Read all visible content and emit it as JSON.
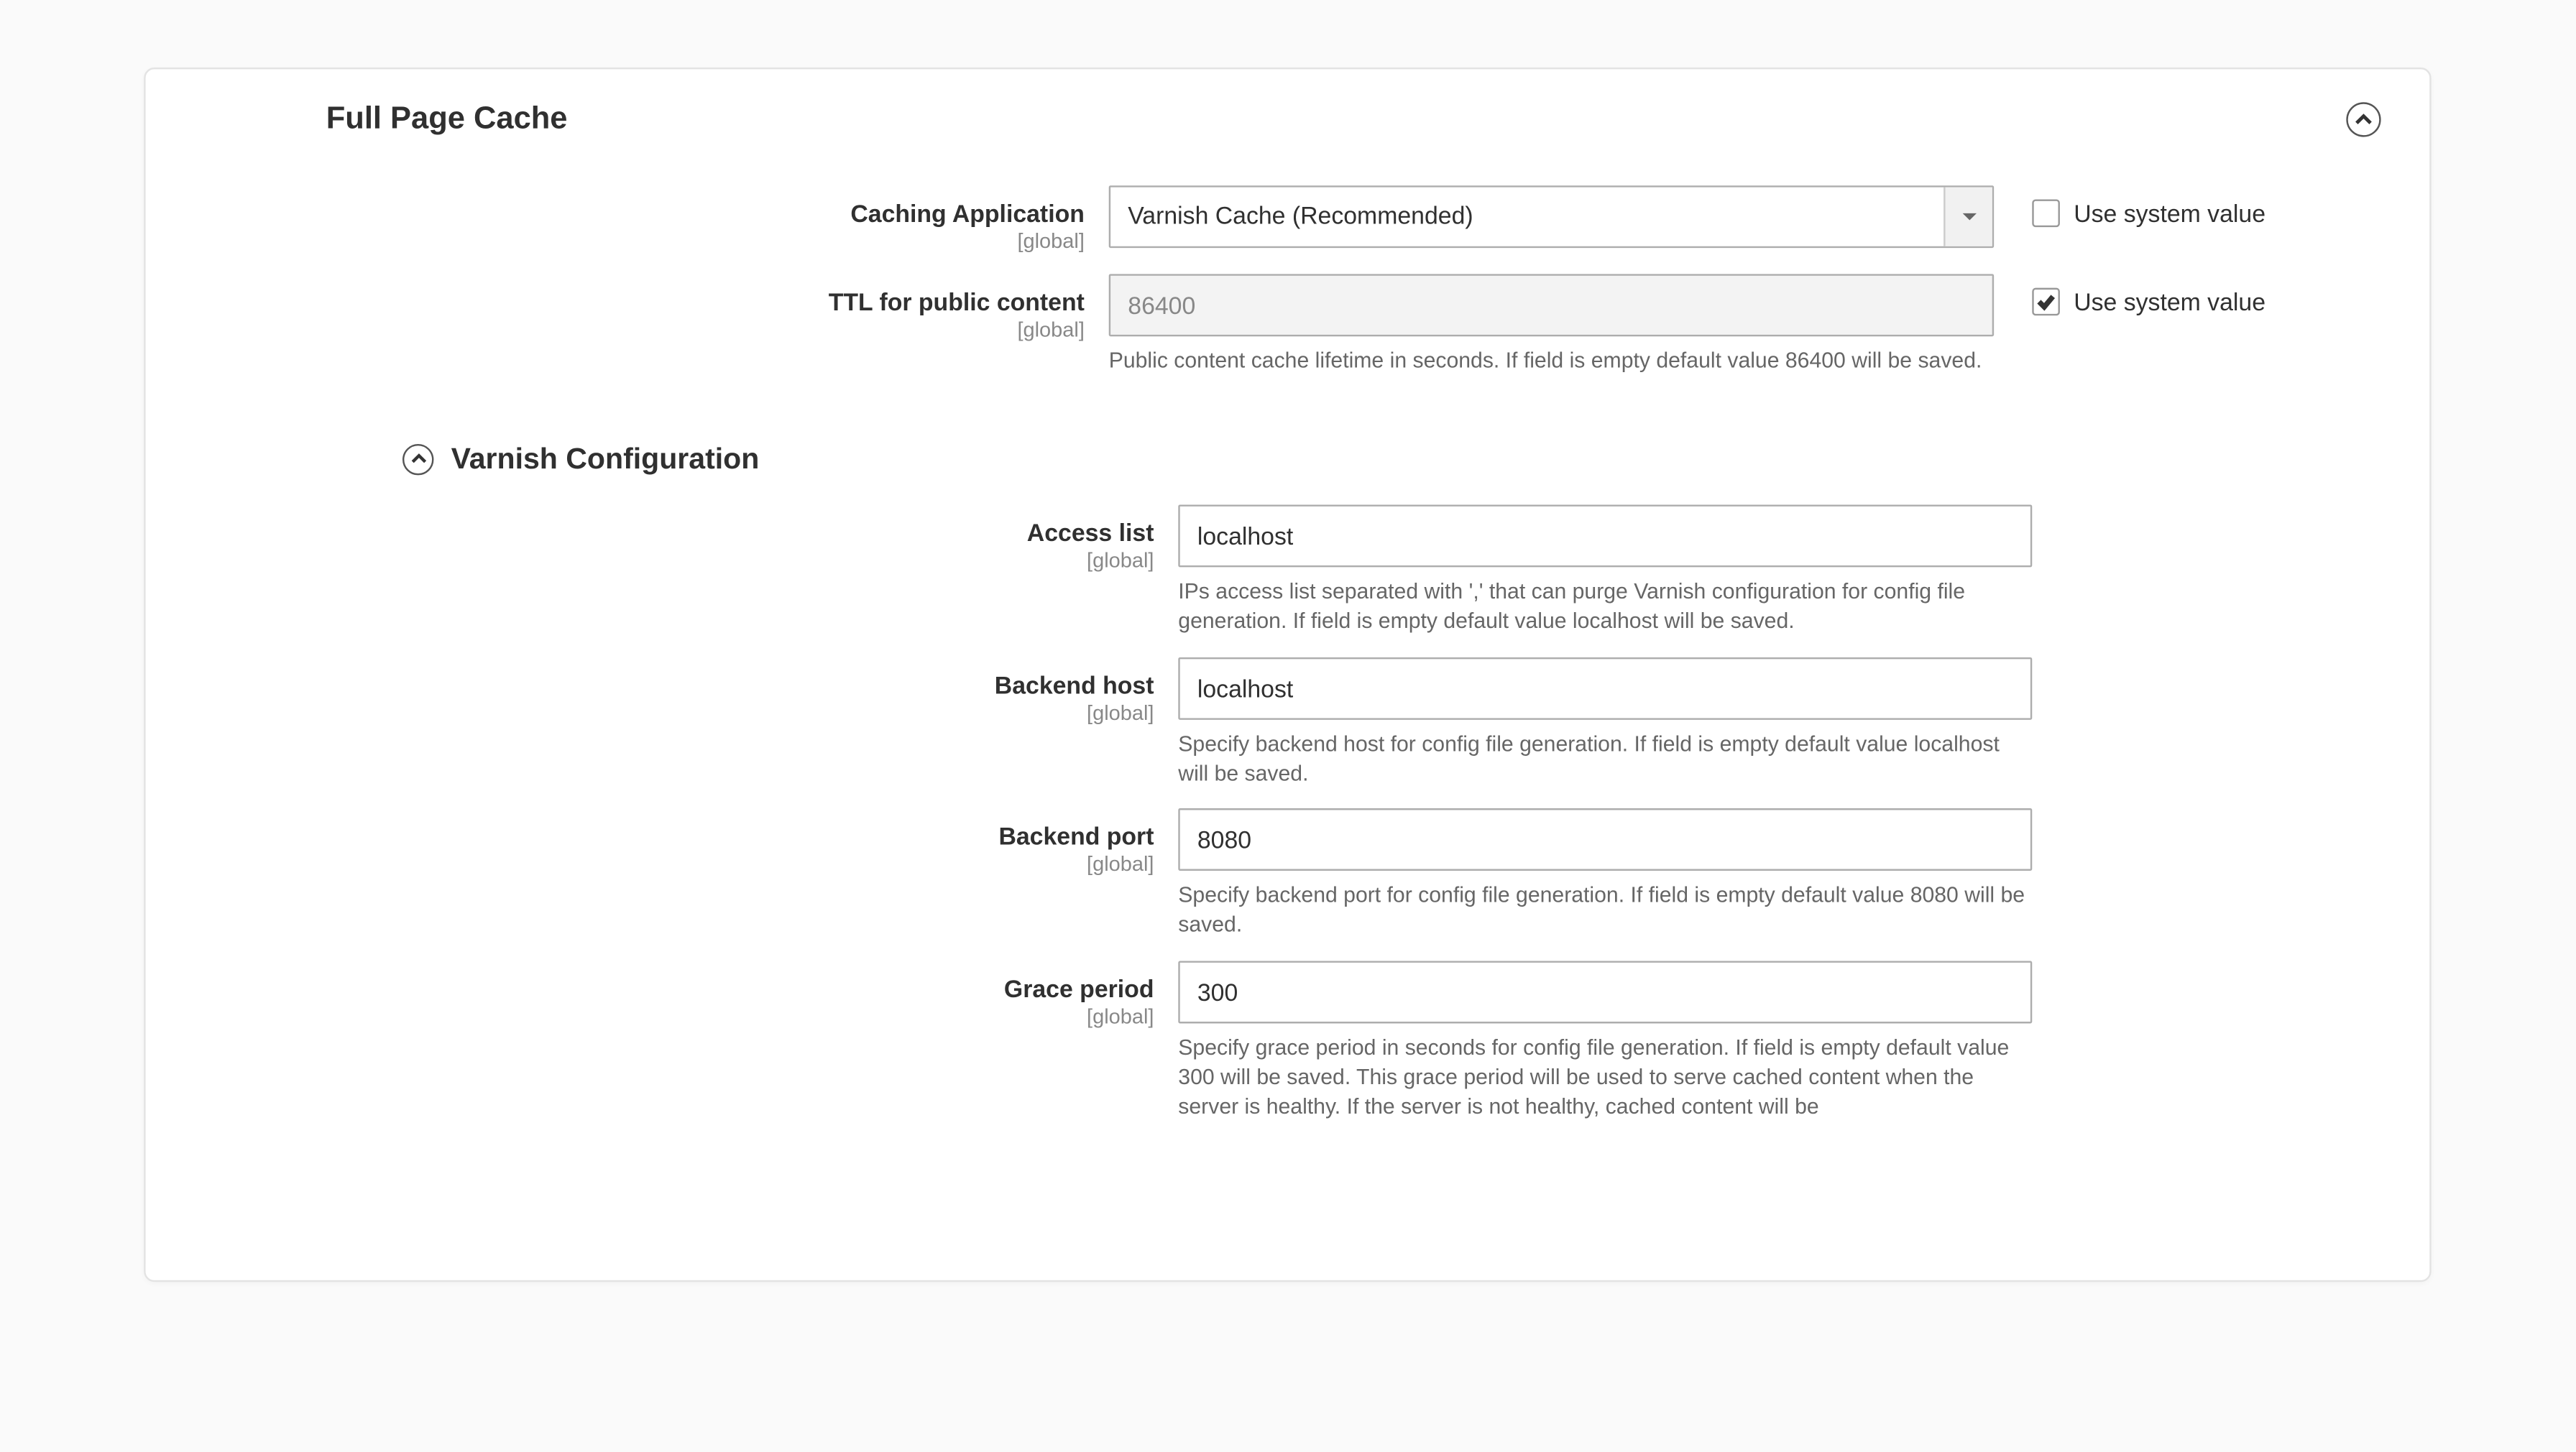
{
  "section": {
    "title": "Full Page Cache"
  },
  "scope": "[global]",
  "fields": {
    "caching_application": {
      "label": "Caching Application",
      "value": "Varnish Cache (Recommended)",
      "use_system_label": "Use system value"
    },
    "ttl": {
      "label": "TTL for public content",
      "value": "86400",
      "help": "Public content cache lifetime in seconds. If field is empty default value 86400 will be saved.",
      "use_system_label": "Use system value"
    }
  },
  "subsection": {
    "title": "Varnish Configuration"
  },
  "varnish": {
    "access_list": {
      "label": "Access list",
      "value": "localhost",
      "help": "IPs access list separated with ',' that can purge Varnish configuration for config file generation. If field is empty default value localhost will be saved."
    },
    "backend_host": {
      "label": "Backend host",
      "value": "localhost",
      "help": "Specify backend host for config file generation. If field is empty default value localhost will be saved."
    },
    "backend_port": {
      "label": "Backend port",
      "value": "8080",
      "help": "Specify backend port for config file generation. If field is empty default value 8080 will be saved."
    },
    "grace_period": {
      "label": "Grace period",
      "value": "300",
      "help": "Specify grace period in seconds for config file generation. If field is empty default value 300 will be saved. This grace period will be used to serve cached content when the server is healthy. If the server is not healthy, cached content will be"
    }
  }
}
